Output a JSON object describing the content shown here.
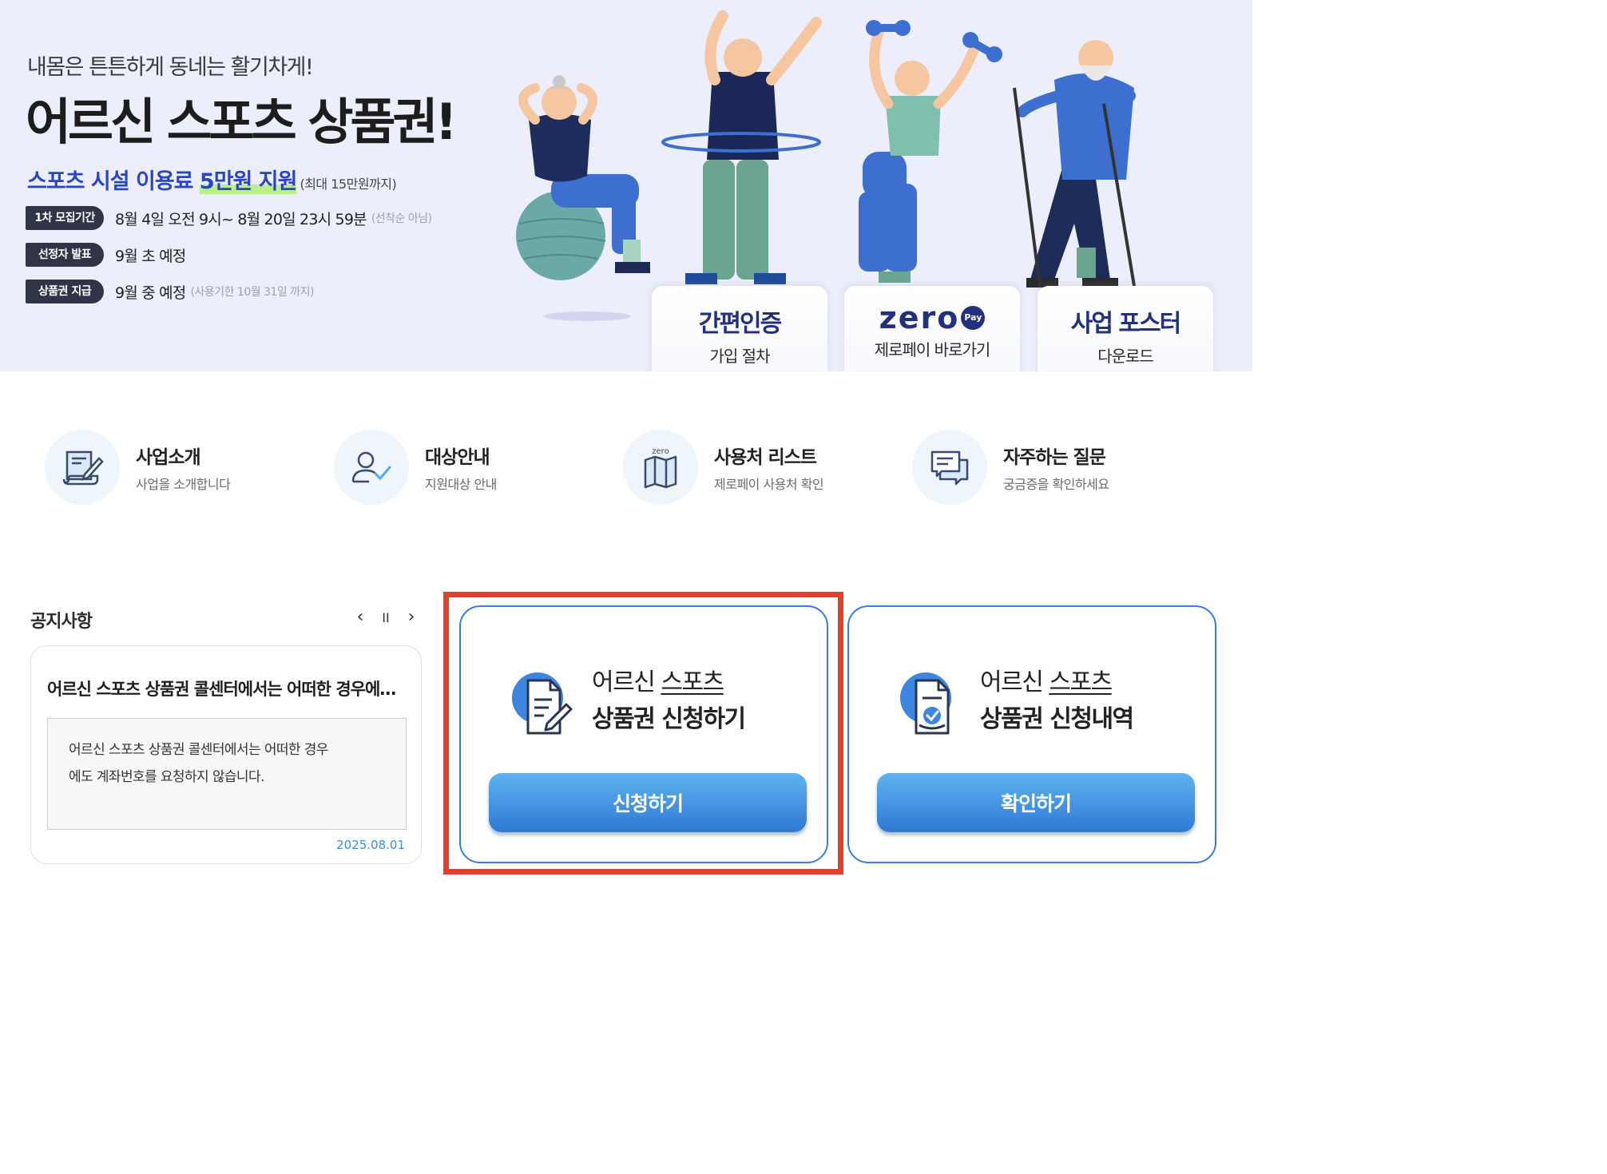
{
  "hero": {
    "subtitle": "내몸은 튼튼하게 동네는 활기차게!",
    "title": "어르신 스포츠 상품권!",
    "support_prefix": "스포츠 시설 이용료 ",
    "support_amount": "5만원 지원",
    "support_note": "(최대 15만원까지)",
    "schedule": [
      {
        "label": "1차 모집기간",
        "text": "8월 4일 오전 9시~ 8월 20일 23시 59분",
        "note": "(선착순 아님)"
      },
      {
        "label": "선정자 발표",
        "text": "9월 초 예정",
        "note": ""
      },
      {
        "label": "상품권 지급",
        "text": "9월 중 예정",
        "note": "(사용기한 10월 31일 까지)"
      }
    ]
  },
  "quick_links": [
    {
      "title": "간편인증",
      "sub": "가입 절차",
      "icon": "simple-auth"
    },
    {
      "title": "zero",
      "badge": "Pay",
      "sub": "제로페이 바로가기",
      "icon": "zeropay-logo"
    },
    {
      "title": "사업 포스터",
      "sub": "다운로드",
      "icon": "poster"
    }
  ],
  "menu": [
    {
      "title": "사업소개",
      "desc": "사업을 소개합니다",
      "icon": "document-pen-icon"
    },
    {
      "title": "대상안내",
      "desc": "지원대상 안내",
      "icon": "user-check-icon"
    },
    {
      "title": "사용처 리스트",
      "desc": "제로페이 사용처 확인",
      "icon": "zero-map-icon",
      "icon_label": "zero"
    },
    {
      "title": "자주하는 질문",
      "desc": "궁금증을 확인하세요",
      "icon": "chat-bubbles-icon"
    }
  ],
  "notice": {
    "label": "공지사항",
    "prev": "‹",
    "pause": "II",
    "next": "›",
    "title": "어르신 스포츠 상품권 콜센터에서는 어떠한 경우에도 계좌번호를 요청하지 않습니다.",
    "body_line1": "어르신 스포츠 상품권 콜센터에서는 어떠한 경우",
    "body_line2": "에도 계좌번호를 요청하지 않습니다.",
    "date": "2025.08.01"
  },
  "apply": {
    "title_line1_a": "어르신 ",
    "title_line1_b": "스포츠",
    "title_line2": "상품권 신청하기",
    "button": "신청하기"
  },
  "history": {
    "title_line1_a": "어르신 ",
    "title_line1_b": "스포츠",
    "title_line2": "상품권 신청내역",
    "button": "확인하기"
  },
  "colors": {
    "hero_bg": "#eceffb",
    "brand_navy": "#23307f",
    "support_blue": "#2a44c9",
    "button_blue": "#2d79d6",
    "card_border": "#3b7bdc",
    "highlight_red": "#e2412a"
  }
}
